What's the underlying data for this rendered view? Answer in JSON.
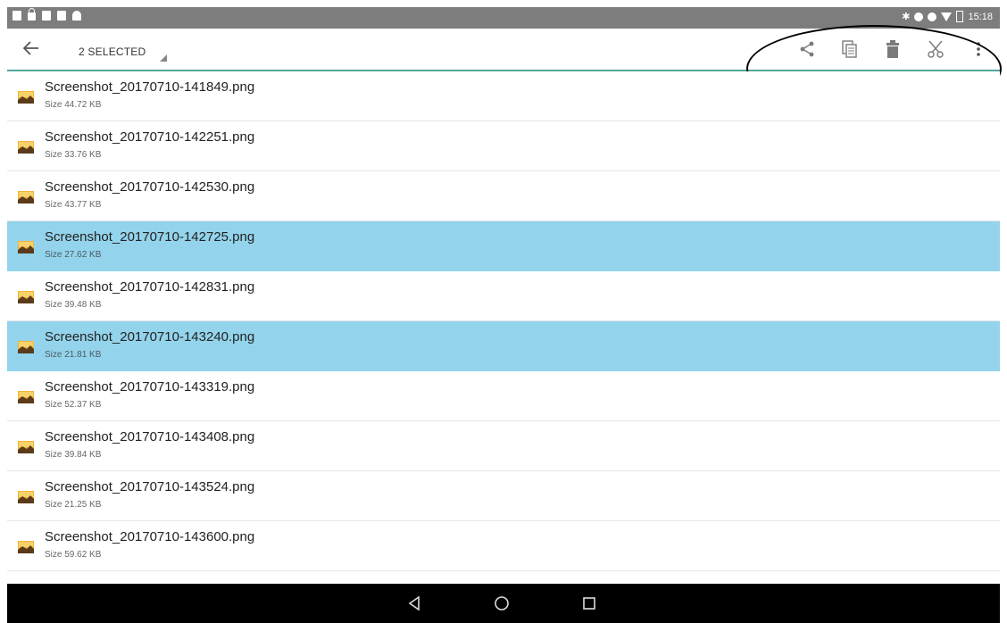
{
  "status_bar": {
    "time": "15:18"
  },
  "toolbar": {
    "selection_label": "2 SELECTED",
    "actions": [
      {
        "name": "share-icon"
      },
      {
        "name": "copy-icon"
      },
      {
        "name": "delete-icon"
      },
      {
        "name": "cut-icon"
      },
      {
        "name": "more-options-icon"
      }
    ]
  },
  "files": [
    {
      "name": "Screenshot_20170710-141849.png",
      "size": "Size 44.72 KB",
      "selected": false
    },
    {
      "name": "Screenshot_20170710-142251.png",
      "size": "Size 33.76 KB",
      "selected": false
    },
    {
      "name": "Screenshot_20170710-142530.png",
      "size": "Size 43.77 KB",
      "selected": false
    },
    {
      "name": "Screenshot_20170710-142725.png",
      "size": "Size 27.62 KB",
      "selected": true
    },
    {
      "name": "Screenshot_20170710-142831.png",
      "size": "Size 39.48 KB",
      "selected": false
    },
    {
      "name": "Screenshot_20170710-143240.png",
      "size": "Size 21.81 KB",
      "selected": true
    },
    {
      "name": "Screenshot_20170710-143319.png",
      "size": "Size 52.37 KB",
      "selected": false
    },
    {
      "name": "Screenshot_20170710-143408.png",
      "size": "Size 39.84 KB",
      "selected": false
    },
    {
      "name": "Screenshot_20170710-143524.png",
      "size": "Size 21.25 KB",
      "selected": false
    },
    {
      "name": "Screenshot_20170710-143600.png",
      "size": "Size 59.62 KB",
      "selected": false
    },
    {
      "name": "",
      "size": "",
      "selected": false
    }
  ],
  "colors": {
    "accent": "#4fa79a",
    "selected_row": "#93d4ec",
    "status_bar": "#7d7d7d",
    "nav_bar": "#000000"
  }
}
